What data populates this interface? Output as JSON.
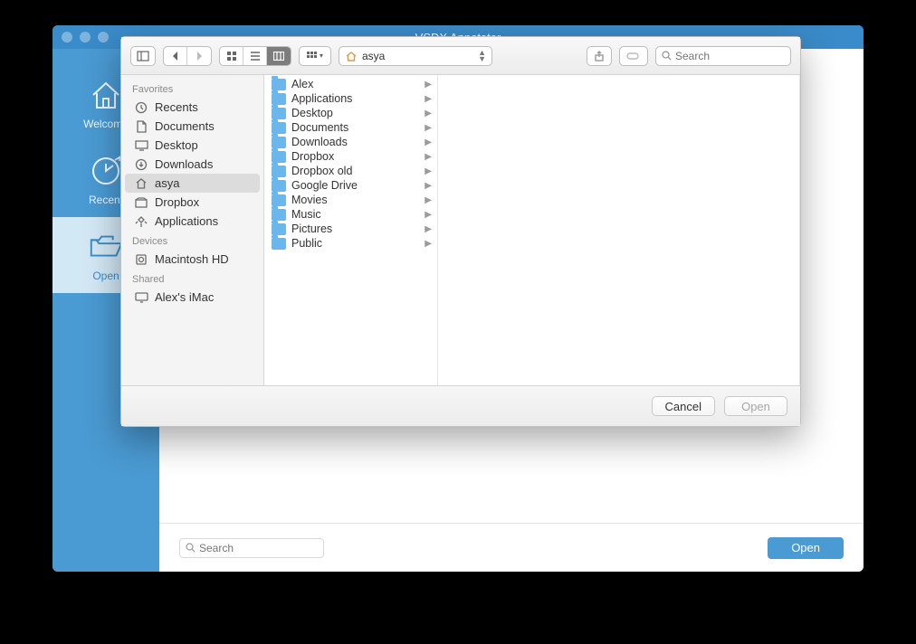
{
  "window": {
    "title": "VSDX Annotator"
  },
  "sidebar": {
    "items": [
      {
        "label": "Welcome",
        "icon": "home"
      },
      {
        "label": "Recent",
        "icon": "clock"
      },
      {
        "label": "Open",
        "icon": "folder-open"
      }
    ]
  },
  "bottom": {
    "search_placeholder": "Search",
    "open_label": "Open"
  },
  "dialog": {
    "path_label": "asya",
    "search_placeholder": "Search",
    "sidebar": {
      "sections": [
        {
          "header": "Favorites",
          "items": [
            {
              "label": "Recents",
              "icon": "recents"
            },
            {
              "label": "Documents",
              "icon": "doc"
            },
            {
              "label": "Desktop",
              "icon": "desktop"
            },
            {
              "label": "Downloads",
              "icon": "downloads"
            },
            {
              "label": "asya",
              "icon": "home",
              "selected": true
            },
            {
              "label": "Dropbox",
              "icon": "dropbox"
            },
            {
              "label": "Applications",
              "icon": "apps"
            }
          ]
        },
        {
          "header": "Devices",
          "items": [
            {
              "label": "Macintosh HD",
              "icon": "disk"
            }
          ]
        },
        {
          "header": "Shared",
          "items": [
            {
              "label": "Alex's iMac",
              "icon": "display"
            }
          ]
        }
      ]
    },
    "column": [
      {
        "label": "Alex"
      },
      {
        "label": "Applications"
      },
      {
        "label": "Desktop"
      },
      {
        "label": "Documents"
      },
      {
        "label": "Downloads"
      },
      {
        "label": "Dropbox"
      },
      {
        "label": "Dropbox old"
      },
      {
        "label": "Google Drive"
      },
      {
        "label": "Movies"
      },
      {
        "label": "Music"
      },
      {
        "label": "Pictures"
      },
      {
        "label": "Public"
      }
    ],
    "buttons": {
      "cancel": "Cancel",
      "open": "Open"
    }
  }
}
